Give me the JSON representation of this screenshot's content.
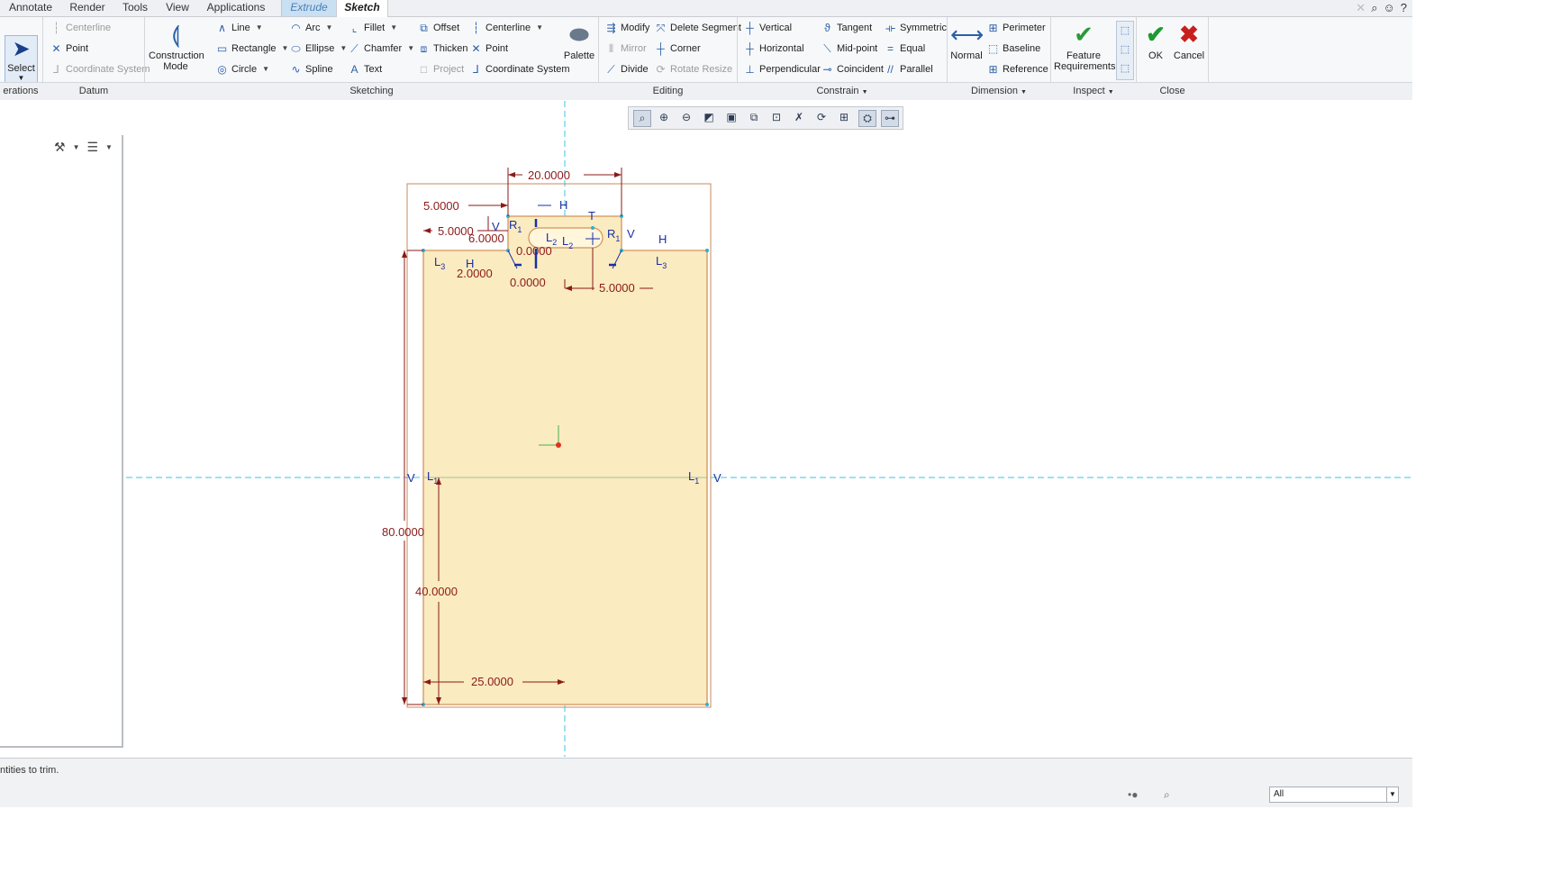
{
  "tabs": [
    {
      "label": "Annotate"
    },
    {
      "label": "Render"
    },
    {
      "label": "Tools"
    },
    {
      "label": "View"
    },
    {
      "label": "Applications"
    },
    {
      "label": "Extrude"
    },
    {
      "label": "Sketch"
    }
  ],
  "ribbon": {
    "select": "Select",
    "datum": {
      "centerline": "Centerline",
      "point": "Point",
      "coord": "Coordinate System"
    },
    "construction_mode": {
      "line1": "Construction",
      "line2": "Mode"
    },
    "sketching": {
      "line": "Line",
      "rectangle": "Rectangle",
      "circle": "Circle",
      "arc": "Arc",
      "ellipse": "Ellipse",
      "spline": "Spline",
      "fillet": "Fillet",
      "chamfer": "Chamfer",
      "text": "Text",
      "offset": "Offset",
      "thicken": "Thicken",
      "project": "Project",
      "centerline": "Centerline",
      "point": "Point",
      "coord": "Coordinate System",
      "palette": "Palette"
    },
    "editing": {
      "modify": "Modify",
      "mirror": "Mirror",
      "divide": "Divide",
      "delete_segment": "Delete Segment",
      "corner": "Corner",
      "rotate_resize": "Rotate Resize"
    },
    "constrain": {
      "vertical": "Vertical",
      "horizontal": "Horizontal",
      "perpendicular": "Perpendicular",
      "tangent": "Tangent",
      "midpoint": "Mid-point",
      "coincident": "Coincident",
      "symmetric": "Symmetric",
      "equal": "Equal",
      "parallel": "Parallel"
    },
    "dimension": {
      "normal": "Normal",
      "perimeter": "Perimeter",
      "baseline": "Baseline",
      "reference": "Reference"
    },
    "inspect": {
      "line1": "Feature",
      "line2": "Requirements"
    },
    "close": {
      "ok": "OK",
      "cancel": "Cancel"
    }
  },
  "groups": {
    "operations": "erations",
    "datum": "Datum",
    "sketching": "Sketching",
    "editing": "Editing",
    "constrain": "Constrain",
    "dimension": "Dimension",
    "inspect": "Inspect",
    "close": "Close"
  },
  "sketch": {
    "dims": {
      "d20": "20.0000",
      "d5a": "5.0000",
      "d15": "5.0000",
      "d6": "6.0000",
      "d0a": "0.0000",
      "d2": "2.0000",
      "d0b": "0.0000",
      "d5b": "5.0000",
      "d80": "80.0000",
      "d40": "40.0000",
      "d25": "25.0000"
    },
    "constraints": {
      "r1a": "R",
      "r1b": "R",
      "sub1": "1",
      "l2a": "L",
      "l2b": "L",
      "sub2": "2",
      "l3a": "L",
      "l3b": "L",
      "sub3": "3",
      "l1a": "L",
      "l1b": "L",
      "h": "H",
      "v": "V",
      "t": "T"
    }
  },
  "status": {
    "message": "ntities to trim.",
    "filter": "All"
  },
  "colors": {
    "fill": "#faebc0",
    "outline": "#d2935a",
    "dimension": "#8b1a1a",
    "constraint": "#1a2fa8",
    "centerline": "#3bc4e0"
  }
}
